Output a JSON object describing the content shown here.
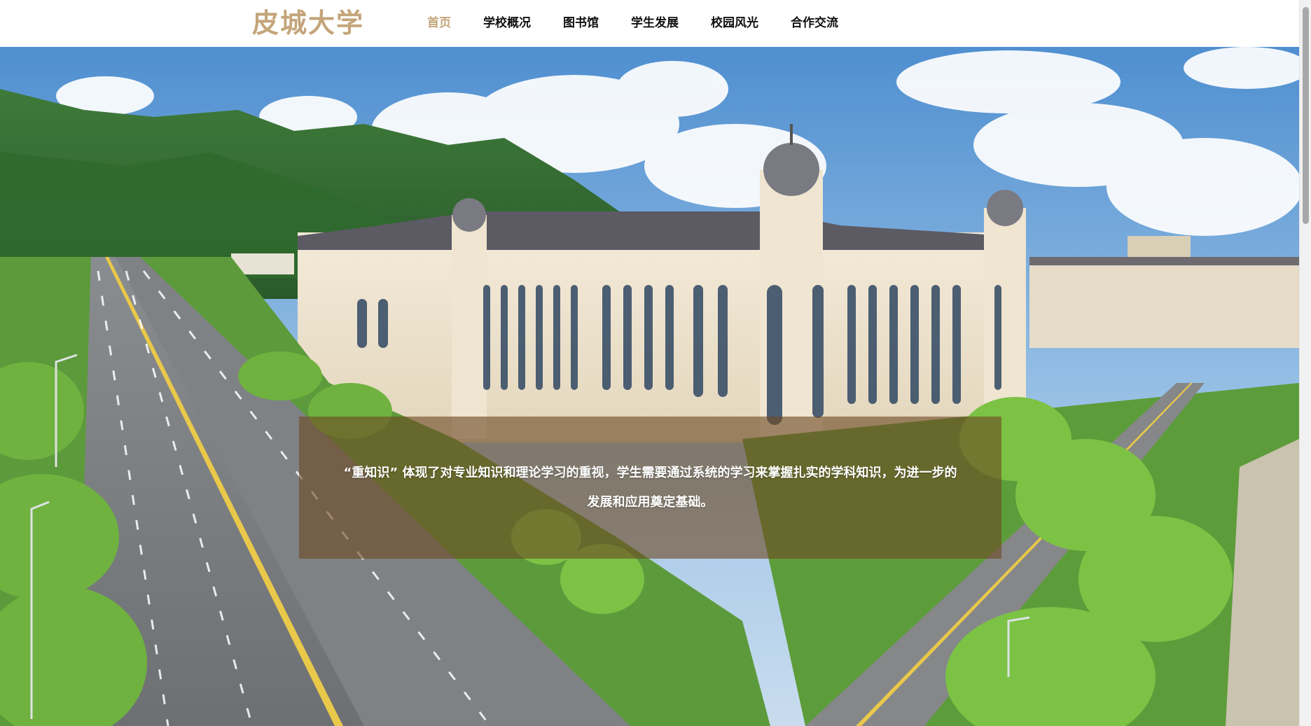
{
  "header": {
    "logo_text": "皮城大学",
    "nav": [
      {
        "label": "首页",
        "active": true
      },
      {
        "label": "学校概况",
        "active": false
      },
      {
        "label": "图书馆",
        "active": false
      },
      {
        "label": "学生发展",
        "active": false
      },
      {
        "label": "校园风光",
        "active": false
      },
      {
        "label": "合作交流",
        "active": false
      }
    ]
  },
  "hero": {
    "caption": "“重知识” 体现了对专业知识和理论学习的重视，学生需要通过系统的学习来掌握扎实的学科知识，为进一步的发展和应用奠定基础。"
  },
  "colors": {
    "brand": "#c4a57a",
    "caption_bg": "rgba(110,75,35,0.62)"
  }
}
